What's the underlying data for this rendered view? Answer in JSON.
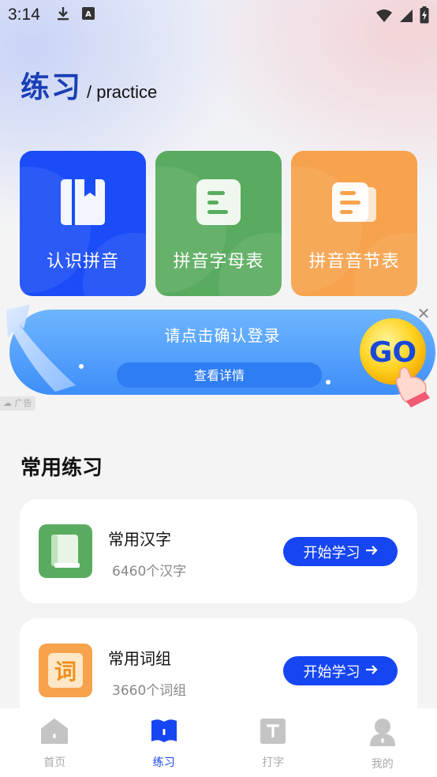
{
  "status_bar": {
    "time": "3:14",
    "icons": [
      "download-icon",
      "keyboard-a-icon",
      "wifi-icon",
      "signal-icon",
      "battery-charging-icon"
    ]
  },
  "header": {
    "title": "练习",
    "subtitle": "/ practice"
  },
  "cards": [
    {
      "label": "认识拼音",
      "icon": "book-bookmark-icon",
      "color": "#1a4df7"
    },
    {
      "label": "拼音字母表",
      "icon": "list-doc-icon",
      "color": "#59ac5f"
    },
    {
      "label": "拼音音节表",
      "icon": "notes-doc-icon",
      "color": "#f7a24c"
    }
  ],
  "banner": {
    "title": "请点击确认登录",
    "button_label": "查看详情",
    "go_text": "GO",
    "close_glyph": "✕",
    "ad_label": "广告"
  },
  "section": {
    "title": "常用练习"
  },
  "practice_items": [
    {
      "title": "常用汉字",
      "subtitle": "6460个汉字",
      "button_label": "开始学习",
      "icon": "green-book-icon",
      "color": "#59ac5f"
    },
    {
      "title": "常用词组",
      "subtitle": "3660个词组",
      "button_label": "开始学习",
      "icon": "ci-character-icon",
      "icon_text": "词",
      "color": "#f7a24c"
    }
  ],
  "tabbar": {
    "tabs": [
      {
        "label": "首页",
        "icon": "home-icon",
        "active": false
      },
      {
        "label": "练习",
        "icon": "book-icon",
        "active": true
      },
      {
        "label": "打字",
        "icon": "type-t-icon",
        "active": false
      },
      {
        "label": "我的",
        "icon": "user-icon",
        "active": false
      }
    ]
  },
  "colors": {
    "accent": "#1645f2",
    "title_blue": "#1a3fb5"
  }
}
